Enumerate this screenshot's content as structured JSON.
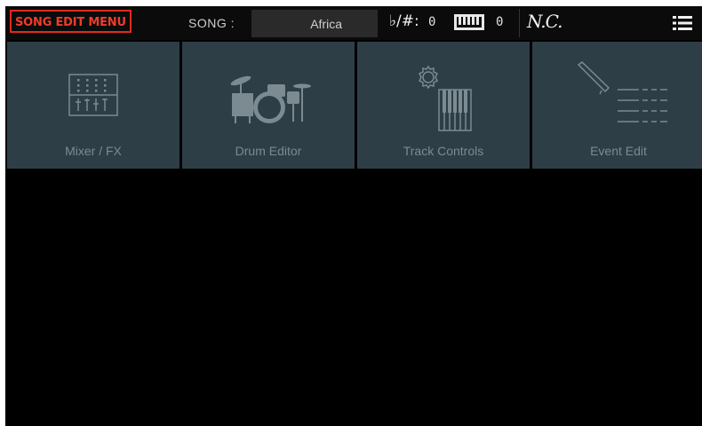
{
  "header": {
    "menu_title": "SONG EDIT MENU",
    "song_label": "SONG :",
    "song_name": "Africa",
    "transpose_label": "♭/#:",
    "transpose_value": "0",
    "keyboard_transpose_value": "0",
    "chord": "N.C."
  },
  "tiles": [
    {
      "label": "Mixer / FX",
      "icon": "mixer-icon"
    },
    {
      "label": "Drum Editor",
      "icon": "drum-kit-icon"
    },
    {
      "label": "Track Controls",
      "icon": "track-controls-icon"
    },
    {
      "label": "Event Edit",
      "icon": "event-edit-icon"
    }
  ],
  "colors": {
    "menu_title": "#ef3c2a",
    "tile_background": "#2e3e46",
    "tile_icon": "#7c8a91",
    "screen_background": "#000000"
  }
}
